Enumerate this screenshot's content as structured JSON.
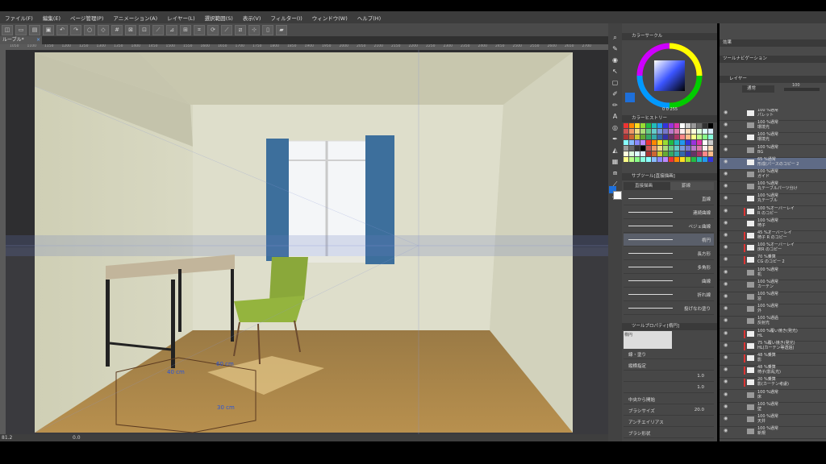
{
  "menu": [
    "ファイル(F)",
    "編集(E)",
    "ページ管理(P)",
    "アニメーション(A)",
    "レイヤー(L)",
    "選択範囲(S)",
    "表示(V)",
    "フィルター(I)",
    "ウィンドウ(W)",
    "ヘルプ(H)"
  ],
  "tab": {
    "label": "ルーブル*",
    "close": "×"
  },
  "ruler_ticks": [
    "1050",
    "1100",
    "1150",
    "1200",
    "1250",
    "1300",
    "1350",
    "1400",
    "1450",
    "1500",
    "1550",
    "1600",
    "1650",
    "1700",
    "1750",
    "1800",
    "1850",
    "1900",
    "1950",
    "2000",
    "2050",
    "2100",
    "2150",
    "2200",
    "2250",
    "2300",
    "2350",
    "2400",
    "2450",
    "2500",
    "2550",
    "2600",
    "2650",
    "2700"
  ],
  "status": {
    "zoom": "81.2",
    "angle": "0.0"
  },
  "annotations": {
    "a": "40 cm",
    "b": "60 cm",
    "c": "30 cm"
  },
  "color_panel": {
    "title": "カラーサークル",
    "values": "0   0   255",
    "history_title": "カラーヒストリー"
  },
  "sub_tool": {
    "title": "サブツール[直接描画]",
    "tab1": "直接描画",
    "tab2": "罫線",
    "items": [
      "直線",
      "連続曲線",
      "ベジェ曲線",
      "楕円",
      "長方形",
      "多角形",
      "曲線",
      "折れ線",
      "投げなわ塗り"
    ]
  },
  "tool_property": {
    "title": "ツールプロパティ[楕円]",
    "brush_name": "楕円",
    "rows": [
      {
        "label": "線・塗り",
        "value": ""
      },
      {
        "label": "縦横指定",
        "value": ""
      },
      {
        "label": "",
        "value": "1.0"
      },
      {
        "label": "",
        "value": "1.0"
      },
      {
        "label": "中央から開始",
        "value": ""
      },
      {
        "label": "ブラシサイズ",
        "value": "20.0"
      },
      {
        "label": "アンチエイリアス",
        "value": ""
      },
      {
        "label": "ブラシ形状",
        "value": ""
      }
    ]
  },
  "right_panel": {
    "effect": "効果",
    "navigator": "ツールナビゲーション",
    "layer_tab": "レイヤー",
    "blend": "通常",
    "opacity": "100"
  },
  "layers": [
    {
      "t1": "100 %通常",
      "t2": "パレット",
      "kind": "thumb"
    },
    {
      "t1": "100 %通常",
      "t2": "環境光",
      "kind": "folder"
    },
    {
      "t1": "100 %通常",
      "t2": "環境光",
      "kind": "thumb"
    },
    {
      "t1": "100 %通常",
      "t2": "BG",
      "kind": "folder"
    },
    {
      "t1": "65 %通常",
      "t2": "形成(パースのコピー 2",
      "kind": "thumb"
    },
    {
      "t1": "100 %通常",
      "t2": "ガイド",
      "kind": "folder"
    },
    {
      "t1": "100 %通常",
      "t2": "丸テーブルパーツ分け",
      "kind": "folder"
    },
    {
      "t1": "100 %通常",
      "t2": "丸テーブル",
      "kind": "thumb"
    },
    {
      "t1": "100 %オーバーレイ",
      "t2": "R のコピー",
      "kind": "thumb"
    },
    {
      "t1": "100 %通常",
      "t2": "椅子",
      "kind": "thumb"
    },
    {
      "t1": "45 %オーバーレイ",
      "t2": "椅子 R のコピー",
      "kind": "thumb"
    },
    {
      "t1": "100 %オーバーレイ",
      "t2": "床R のコピー",
      "kind": "thumb"
    },
    {
      "t1": "70 %乗算",
      "t2": "CG のコピー 2",
      "kind": "thumb"
    },
    {
      "t1": "100 %通常",
      "t2": "机",
      "kind": "folder"
    },
    {
      "t1": "100 %通常",
      "t2": "カーテン",
      "kind": "folder"
    },
    {
      "t1": "100 %通常",
      "t2": "窓",
      "kind": "folder"
    },
    {
      "t1": "100 %通常",
      "t2": "外",
      "kind": "folder"
    },
    {
      "t1": "100 %通過",
      "t2": "反射光",
      "kind": "folder"
    },
    {
      "t1": "100 %覆い焼き(発光)",
      "t2": "HL",
      "kind": "thumb"
    },
    {
      "t1": "75 %覆い焼き(発光)",
      "t2": "HL(カーテン等透過)",
      "kind": "thumb"
    },
    {
      "t1": "48 %乗算",
      "t2": "影",
      "kind": "thumb"
    },
    {
      "t1": "48 %乗算",
      "t2": "椅子(影乱光)",
      "kind": "thumb"
    },
    {
      "t1": "20 %乗算",
      "t2": "影(カーテン考慮)",
      "kind": "thumb"
    },
    {
      "t1": "100 %通常",
      "t2": "床",
      "kind": "folder"
    },
    {
      "t1": "100 %通常",
      "t2": "壁",
      "kind": "folder"
    },
    {
      "t1": "100 %通常",
      "t2": "天井",
      "kind": "folder"
    },
    {
      "t1": "100 %通常",
      "t2": "新規",
      "kind": "folder"
    }
  ],
  "colors": {
    "accent": "#1e6fd9",
    "canvas_bg": "#2d2d2d",
    "panel": "#474747"
  }
}
